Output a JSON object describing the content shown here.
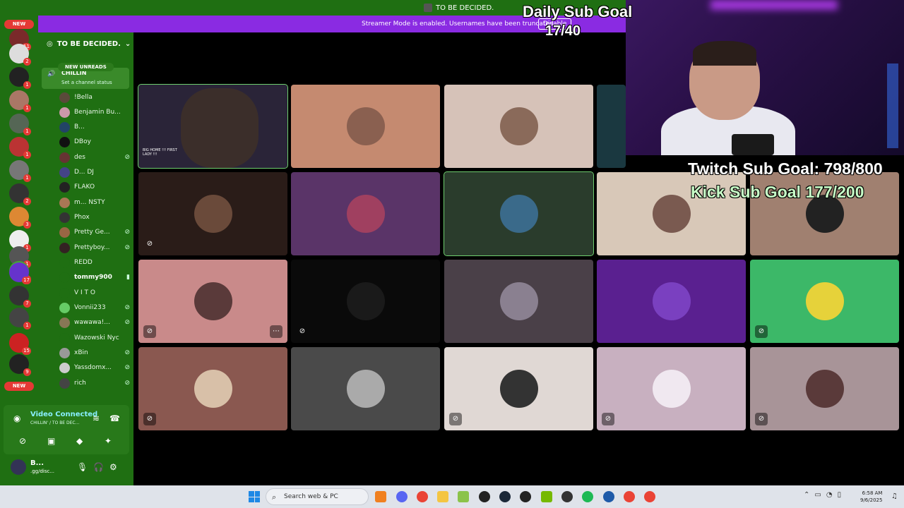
{
  "topbar": {
    "title": "TO BE DECIDED."
  },
  "banner": {
    "message": "Streamer Mode is enabled. Usernames have been truncated.",
    "dismiss_label": "Disable"
  },
  "server_list": {
    "new_label": "NEW",
    "badges": [
      "11",
      "2",
      "1",
      "1",
      "1",
      "1",
      "1",
      "2",
      "3",
      "1",
      "1",
      "1",
      "17",
      "7",
      "1",
      "15",
      "9",
      "7"
    ]
  },
  "channel_sidebar": {
    "server_name": "TO BE DECIDED.",
    "new_unreads": "NEW UNREADS",
    "voice_channel": {
      "name": "CHILLIN",
      "status_placeholder": "Set a channel status"
    },
    "members": [
      {
        "name": "!Bella"
      },
      {
        "name": "Benjamin Bu..."
      },
      {
        "name": "B..."
      },
      {
        "name": "DBoy"
      },
      {
        "name": "des"
      },
      {
        "name": "D... DJ"
      },
      {
        "name": "FLAKO"
      },
      {
        "name": "m... NSTY"
      },
      {
        "name": "Phox"
      },
      {
        "name": "Pretty Ge..."
      },
      {
        "name": "Prettyboy..."
      },
      {
        "name": "REDD"
      },
      {
        "name": "tommy900"
      },
      {
        "name": "V I T O"
      },
      {
        "name": "Vonnii233"
      },
      {
        "name": "wawawa!..."
      },
      {
        "name": "Wazowski Nyc"
      },
      {
        "name": "xBin"
      },
      {
        "name": "Yassdomx..."
      },
      {
        "name": "rich"
      }
    ]
  },
  "voice_panel": {
    "status": "Video Connected",
    "location": "CHILLIN' / TO BE DEC..."
  },
  "user_panel": {
    "name": "B...",
    "status": ".gg/disc..."
  },
  "overlay": {
    "daily_goal_title": "Daily Sub Goal",
    "daily_goal_value": "17/40",
    "twitch_goal": "Twitch Sub Goal: 798/800",
    "kick_goal": "Kick Sub Goal  177/200"
  },
  "stage": {
    "tile_caption": "BIG HOME !!! FIRST LADY !!!"
  },
  "colors": {
    "discord_green": "#1f6f12",
    "streamer_banner": "#8a2be2",
    "notification_red": "#e53935"
  },
  "taskbar": {
    "search_placeholder": "Search web & PC",
    "time": "6:58 AM",
    "date": "9/6/2025"
  }
}
